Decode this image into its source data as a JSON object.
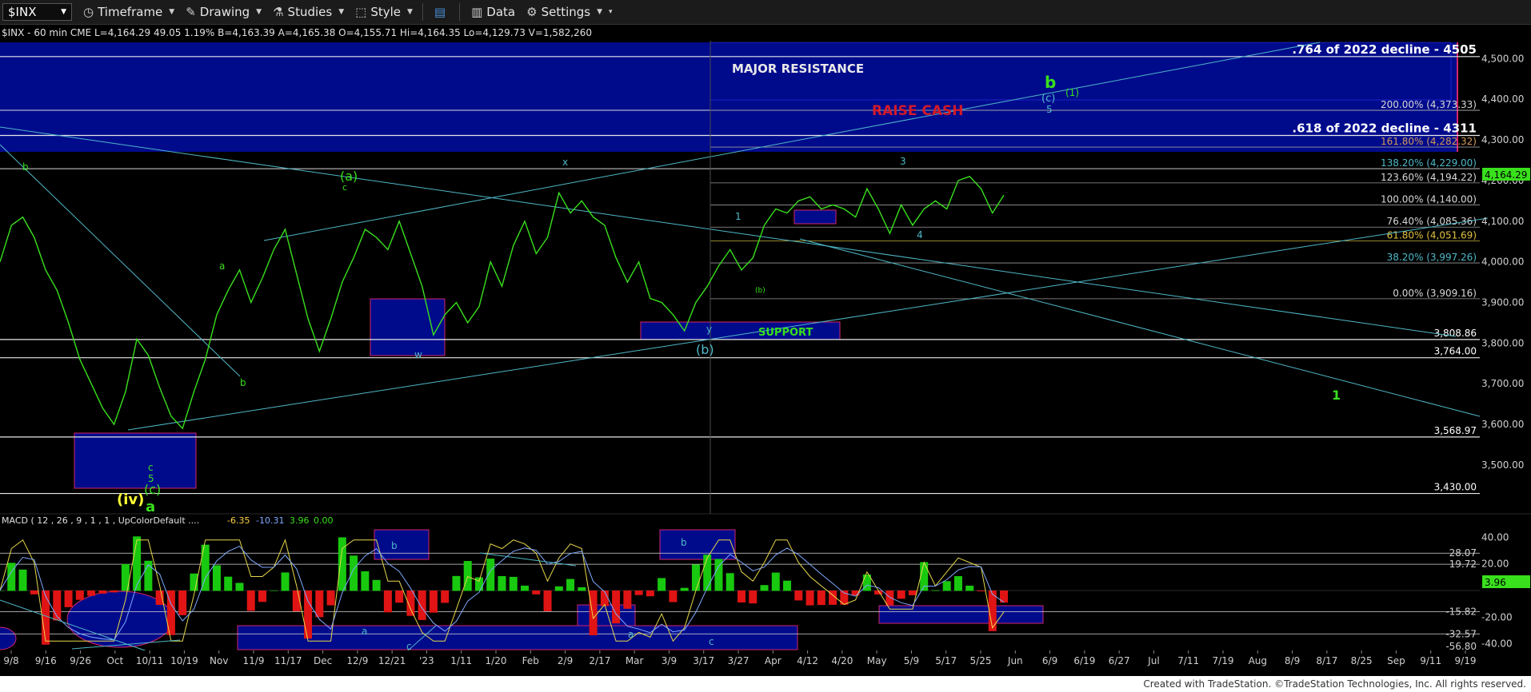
{
  "toolbar": {
    "symbol": "$INX",
    "timeframe": "Timeframe",
    "drawing": "Drawing",
    "studies": "Studies",
    "style": "Style",
    "data": "Data",
    "settings": "Settings"
  },
  "header_line": "$INX - 60 min CME L=4,164.29 49.05 1.19% B=4,163.39 A=4,165.38 O=4,155.71 Hi=4,164.35 Lo=4,129.73 V=1,582,260",
  "macd_header": {
    "label": "MACD ( 12 , 26 , 9 , 1 , 1 , UpColorDefault ....",
    "macd": "-6.35",
    "avg": "-10.31",
    "diff": "3.96",
    "zero": "0.00"
  },
  "footer": "Created with TradeStation. ©TradeStation Technologies, Inc. All rights reserved.",
  "colors": {
    "price": "#39e01c",
    "level": "#e8e8e8",
    "trend": "#4fb8c8",
    "box": "#000b8c",
    "box_border": "#d4246c",
    "fib": "#cccccc"
  },
  "chart_data": [
    {
      "type": "line",
      "title": "$INX - 60 min",
      "ylim": [
        3380,
        4540
      ],
      "yticks": [
        3500,
        3600,
        3700,
        3800,
        3900,
        4000,
        4100,
        4200,
        4300,
        4400,
        4500
      ],
      "ytick_labels": [
        "3,500.00",
        "3,600.00",
        "3,700.00",
        "3,800.00",
        "3,900.00",
        "4,000.00",
        "4,100.00",
        "4,200.00",
        "4,300.00",
        "4,400.00",
        "4,500.00"
      ],
      "xtick_labels": [
        "9/8",
        "9/16",
        "9/26",
        "Oct",
        "10/11",
        "10/19",
        "Nov",
        "11/9",
        "11/17",
        "Dec",
        "12/9",
        "12/21",
        "'23",
        "1/11",
        "1/20",
        "Feb",
        "2/9",
        "2/17",
        "Mar",
        "3/9",
        "3/17",
        "3/27",
        "Apr",
        "4/12",
        "4/20",
        "May",
        "5/9",
        "5/17",
        "5/25",
        "Jun",
        "6/9",
        "6/19",
        "6/27",
        "Jul",
        "7/11",
        "7/19",
        "Aug",
        "8/9",
        "8/17",
        "8/25",
        "Sep",
        "9/11",
        "9/19"
      ],
      "last_price": "4,164.29",
      "series": [
        {
          "values": [
            4000,
            4090,
            4110,
            4060,
            3980,
            3930,
            3850,
            3760,
            3700,
            3640,
            3600,
            3680,
            3810,
            3770,
            3690,
            3620,
            3590,
            3680,
            3760,
            3870,
            3930,
            3980,
            3900,
            3960,
            4030,
            4080,
            3970,
            3860,
            3780,
            3860,
            3950,
            4010,
            4080,
            4060,
            4030,
            4100,
            4020,
            3940,
            3820,
            3870,
            3900,
            3850,
            3890,
            4000,
            3940,
            4040,
            4100,
            4020,
            4060,
            4170,
            4120,
            4150,
            4110,
            4090,
            4010,
            3950,
            4000,
            3910,
            3900,
            3870,
            3830,
            3900,
            3940,
            3990,
            4030,
            3980,
            4010,
            4090,
            4130,
            4120,
            4150,
            4160,
            4130,
            4140,
            4130,
            4110,
            4180,
            4130,
            4070,
            4140,
            4090,
            4130,
            4150,
            4130,
            4200,
            4210,
            4180,
            4120,
            4164
          ]
        }
      ],
      "levels": [
        {
          "value": 4505,
          "label": ".764 of 2022 decline - 4505"
        },
        {
          "value": 4311,
          "label": ".618 of 2022 decline - 4311"
        },
        {
          "value": 3808.86,
          "label": "3,808.86"
        },
        {
          "value": 3764.0,
          "label": "3,764.00"
        },
        {
          "value": 3568.97,
          "label": "3,568.97"
        },
        {
          "value": 3430.0,
          "label": "3,430.00"
        }
      ],
      "fib_levels": [
        {
          "value": 4373,
          "label": "200.00% (4,373.33)"
        },
        {
          "value": 4282.32,
          "label": "161.80% (4,282.32)"
        },
        {
          "value": 4229,
          "label": "138.20% (4,229.00)"
        },
        {
          "value": 4194.22,
          "label": "123.60% (4,194.22)"
        },
        {
          "value": 4140,
          "label": "100.00% (4,140.00)"
        },
        {
          "value": 4085.36,
          "label": "76.40% (4,085.36)"
        },
        {
          "value": 4051.69,
          "label": "61.80% (4,051.69)"
        },
        {
          "value": 3997.26,
          "label": "38.20% (3,997.26)"
        },
        {
          "value": 3909.16,
          "label": "0.00% (3,909.16)"
        }
      ],
      "zone_labels": {
        "resistance": "MAJOR RESISTANCE",
        "raise_cash": "RAISE CASH",
        "support": "SUPPORT"
      },
      "wave_labels": [
        "b",
        "(a)",
        "c",
        "a",
        "b",
        "w",
        "x",
        "y",
        "(b)",
        "1",
        "(b)",
        "3",
        "4",
        "b",
        "(c)",
        "(1)",
        "5",
        "1",
        "c",
        "5",
        "(c)",
        "(iv)",
        "a"
      ]
    },
    {
      "type": "line",
      "title": "MACD ( 12 , 26 , 9 , 1 , 1 , UpColorDefault ....",
      "ylim": [
        -45,
        48
      ],
      "yticks": [
        40,
        20,
        -20,
        -40
      ],
      "ytick_labels": [
        "40.00",
        "20.00",
        "-20.00",
        "-40.00"
      ],
      "levels": [
        {
          "value": 28.07,
          "label": "28.07"
        },
        {
          "value": 19.72,
          "label": "19.72"
        },
        {
          "value": -15.82,
          "label": "-15.82"
        },
        {
          "value": -32.57,
          "label": "-32.57"
        },
        {
          "value": -56.8,
          "label": "-56.80"
        }
      ],
      "current": "3.96",
      "box_labels": [
        "b",
        "b"
      ],
      "wave_labels": [
        "a",
        "c",
        "a",
        "c"
      ]
    }
  ]
}
